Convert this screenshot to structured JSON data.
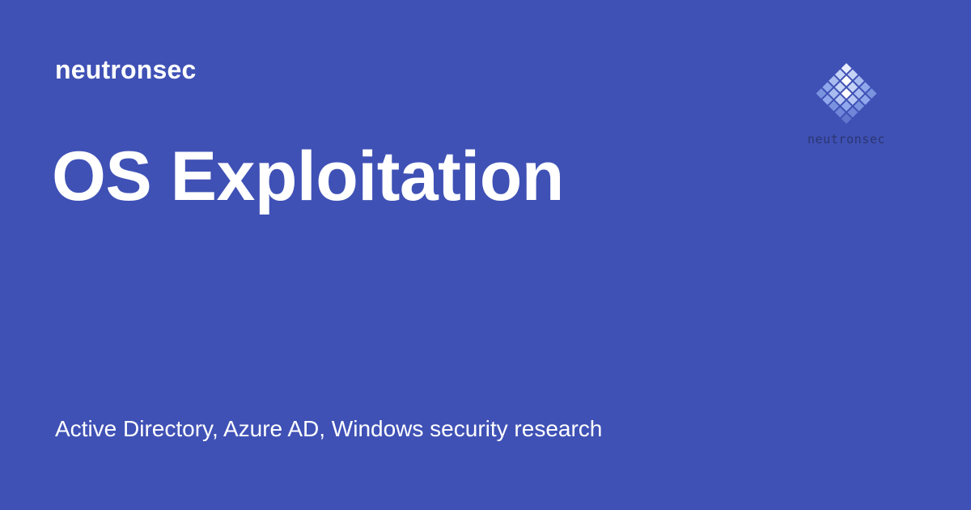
{
  "site": {
    "name": "neutronsec"
  },
  "page": {
    "title": "OS Exploitation",
    "description": "Active Directory, Azure AD, Windows security research"
  },
  "logo": {
    "icon": "diamond-pixel-grid-icon",
    "wordmark": "neutronsec"
  },
  "colors": {
    "background": "#3f51b5",
    "text": "#ffffff",
    "logo_light": "#c5d3f7",
    "logo_mid": "#8fa8ec",
    "logo_dark": "#6f86d9",
    "logo_wordmark": "#2b3570"
  }
}
